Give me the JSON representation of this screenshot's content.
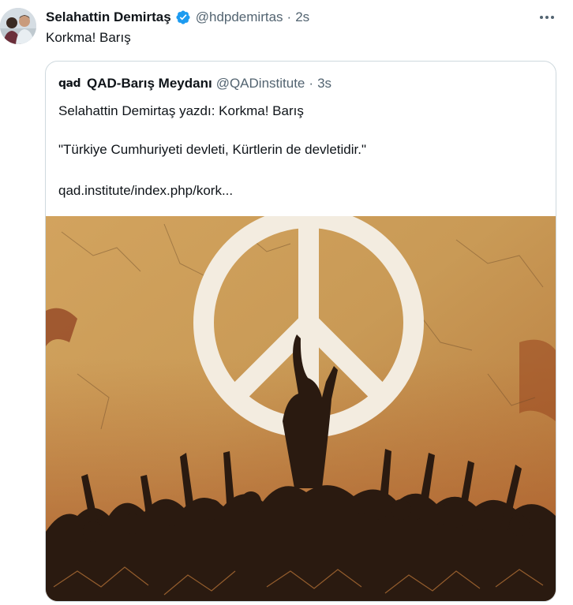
{
  "tweet": {
    "author_name": "Selahattin Demirtaş",
    "handle": "@hdpdemirtas",
    "separator": "·",
    "time": "2s",
    "text": "Korkma! Barış"
  },
  "quote": {
    "logo_text": "qad",
    "author_name": "QAD-Barış Meydanı",
    "handle": "@QADinstitute",
    "separator": "·",
    "time": "3s",
    "line1": "Selahattin Demirtaş yazdı: Korkma! Barış",
    "line2": "\"Türkiye Cumhuriyeti devleti, Kürtlerin de devletidir.\"",
    "line3": "qad.institute/index.php/kork..."
  },
  "icons": {
    "verified": "verified-badge-icon",
    "more": "more-options-icon"
  },
  "colors": {
    "verified_blue": "#1d9bf0",
    "secondary_text": "#536471",
    "border": "#cfd9de",
    "image_background": "#c89a55"
  }
}
